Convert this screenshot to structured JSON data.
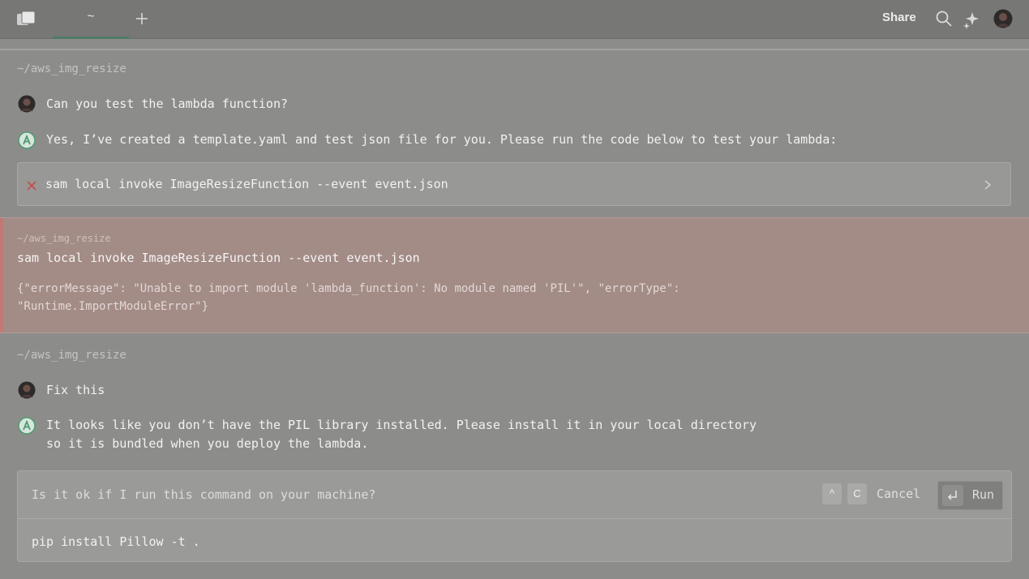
{
  "topbar": {
    "tab_label": "~",
    "new_tab_icon": "plus-icon",
    "share_label": "Share",
    "icons": [
      "search-icon",
      "sparkle-icon",
      "avatar"
    ]
  },
  "session1": {
    "path": "~/aws_img_resize",
    "user_message": "Can you test the lambda function?",
    "ai_message": "Yes, I’ve created a template.yaml and test json file for you. Please run the code below to test your lambda:",
    "command": "sam local invoke ImageResizeFunction --event event.json"
  },
  "error_block": {
    "path": "~/aws_img_resize",
    "command": "sam local invoke ImageResizeFunction --event event.json",
    "output_line1": "{\"errorMessage\": \"Unable to import module 'lambda_function': No module named 'PIL'\", \"errorType\":",
    "output_line2": "\"Runtime.ImportModuleError\"}"
  },
  "session2": {
    "path": "~/aws_img_resize",
    "user_message": "Fix this",
    "ai_message_line1": "It looks like you don’t have the PIL library installed. Please install it in your local directory",
    "ai_message_line2": "so it is bundled when you deploy the lambda."
  },
  "run_prompt": {
    "question": "Is it ok if I run this command on your machine?",
    "key_ctrl": "^",
    "key_c": "C",
    "cancel_label": "Cancel",
    "run_label": "Run",
    "command": "pip install Pillow -t ."
  },
  "colors": {
    "error_accent": "#c07973",
    "ai_avatar": "#4f9a70",
    "tab_underline": "#4f7a64"
  }
}
